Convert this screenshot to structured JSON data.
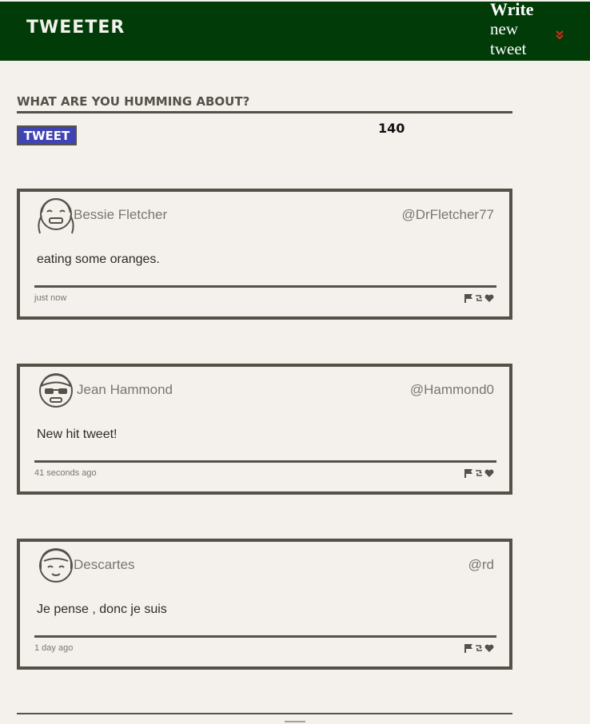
{
  "nav": {
    "brand": "TWEETER",
    "write_line1": "Write",
    "write_line2": "new",
    "write_line3": "tweet",
    "chevron_icon": "chevron-double-down-icon",
    "chevron_color": "#e02a1a"
  },
  "compose": {
    "placeholder": "What are you humming about?",
    "value": "",
    "button_label": "TWEET",
    "counter": "140"
  },
  "tweets": [
    {
      "name": "Bessie Fletcher",
      "handle": "@DrFletcher77",
      "body": "eating some oranges.",
      "time": "just now",
      "avatar_icon": "avatar-girl-pigtails-icon"
    },
    {
      "name": "Jean Hammond",
      "handle": "@Hammond0",
      "body": "New hit tweet!",
      "time": "41 seconds ago",
      "avatar_icon": "avatar-sunglasses-icon"
    },
    {
      "name": "Descartes",
      "handle": "@rd",
      "body": "Je pense , donc je suis",
      "time": "1 day ago",
      "avatar_icon": "avatar-bob-hair-icon"
    }
  ],
  "colors": {
    "nav_bg": "#003b08",
    "page_bg": "#f4f1ec",
    "border": "#545149",
    "tweet_button_bg": "#4043b3"
  }
}
